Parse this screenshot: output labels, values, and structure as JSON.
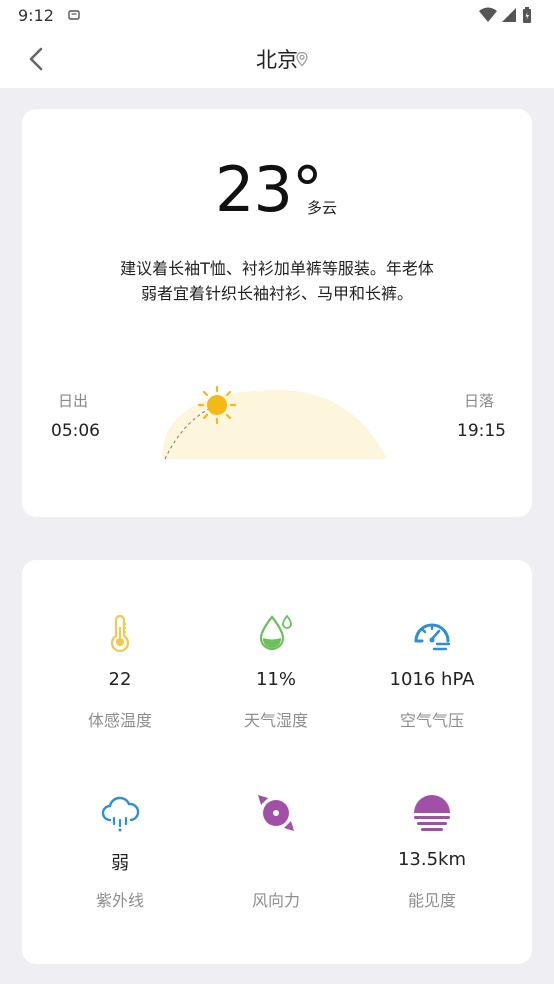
{
  "status_bar": {
    "time": "9:12"
  },
  "header": {
    "city": "北京"
  },
  "weather": {
    "temperature": "23°",
    "condition": "多云",
    "advice": "建议着长袖T恤、衬衫加单裤等服装。年老体弱者宜着针织长袖衬衫、马甲和长裤。",
    "sunrise_label": "日出",
    "sunrise_time": "05:06",
    "sunset_label": "日落",
    "sunset_time": "19:15"
  },
  "details": [
    {
      "icon": "thermometer-icon",
      "value": "22",
      "label": "体感温度",
      "color": "#f2c94c"
    },
    {
      "icon": "humidity-icon",
      "value": "11%",
      "label": "天气湿度",
      "color": "#6cc05a"
    },
    {
      "icon": "pressure-gauge-icon",
      "value": "1016 hPA",
      "label": "空气气压",
      "color": "#2d8fd5"
    },
    {
      "icon": "uv-rain-cloud-icon",
      "value": "弱",
      "label": "紫外线",
      "color": "#2d8fd5"
    },
    {
      "icon": "wind-direction-icon",
      "value": "",
      "label": "风向力",
      "color": "#a14fa7"
    },
    {
      "icon": "visibility-icon",
      "value": "13.5km",
      "label": "能见度",
      "color": "#a14fa7"
    }
  ],
  "colors": {
    "background": "#eeeef3",
    "card": "#ffffff",
    "sun": "#f5b915",
    "sun_arc_fill": "#fdf6dc",
    "label_gray": "#8e8e8e"
  }
}
